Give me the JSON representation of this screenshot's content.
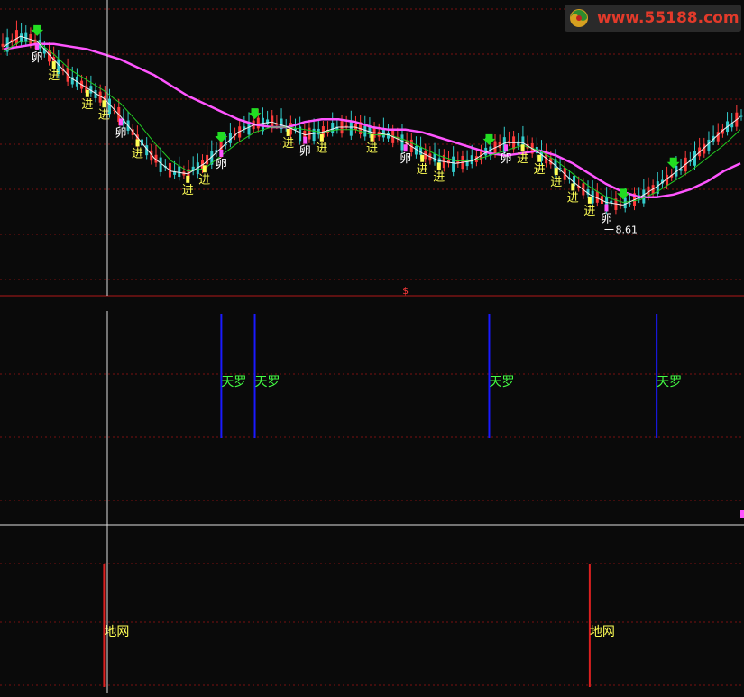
{
  "watermark": {
    "text": "www.55188.com"
  },
  "colors": {
    "background": "#0a0a0a",
    "grid": "#7a1010",
    "up": "#ff3b3b",
    "down": "#33cccc",
    "ma_long": "#ff55ff",
    "ma_mid": "#22cc22",
    "ma_short": "#f0f0f0",
    "signal_in": "#ffff55",
    "signal_out": "#ffffff",
    "arrow_down": "#22dd22",
    "skynet_line": "#1a1aff",
    "skynet_label": "#44ff44",
    "earthnet_line": "#dd2020",
    "earthnet_label": "#ffff55",
    "crosshair": "#dddddd"
  },
  "chart_data": [
    {
      "type": "candlestick",
      "title": "",
      "grid": true,
      "series": [
        {
          "name": "MA long",
          "color": "#ff55ff",
          "values": [
            0.88,
            0.89,
            0.9,
            0.9,
            0.89,
            0.88,
            0.86,
            0.84,
            0.81,
            0.78,
            0.74,
            0.7,
            0.67,
            0.64,
            0.61,
            0.59,
            0.58,
            0.58,
            0.6,
            0.61,
            0.61,
            0.6,
            0.58,
            0.57,
            0.57,
            0.56,
            0.54,
            0.52,
            0.5,
            0.48,
            0.47,
            0.48,
            0.49,
            0.47,
            0.44,
            0.4,
            0.36,
            0.33,
            0.31,
            0.31,
            0.32,
            0.34,
            0.37,
            0.41,
            0.44
          ]
        },
        {
          "name": "MA mid",
          "color": "#22cc22",
          "values": [
            0.87,
            0.91,
            0.91,
            0.86,
            0.8,
            0.76,
            0.72,
            0.67,
            0.6,
            0.52,
            0.45,
            0.41,
            0.42,
            0.47,
            0.52,
            0.56,
            0.58,
            0.58,
            0.57,
            0.56,
            0.57,
            0.57,
            0.55,
            0.55,
            0.53,
            0.5,
            0.47,
            0.45,
            0.45,
            0.47,
            0.49,
            0.51,
            0.49,
            0.45,
            0.4,
            0.35,
            0.31,
            0.29,
            0.3,
            0.33,
            0.37,
            0.41,
            0.46,
            0.51,
            0.57
          ]
        },
        {
          "name": "MA short",
          "color": "#f0f0f0",
          "values": [
            0.89,
            0.93,
            0.91,
            0.84,
            0.77,
            0.73,
            0.69,
            0.62,
            0.54,
            0.46,
            0.41,
            0.4,
            0.44,
            0.5,
            0.56,
            0.59,
            0.6,
            0.58,
            0.55,
            0.56,
            0.58,
            0.58,
            0.56,
            0.55,
            0.52,
            0.48,
            0.45,
            0.44,
            0.45,
            0.49,
            0.52,
            0.52,
            0.48,
            0.43,
            0.37,
            0.32,
            0.29,
            0.28,
            0.31,
            0.35,
            0.4,
            0.45,
            0.51,
            0.57,
            0.62
          ]
        }
      ],
      "signals": [
        {
          "label": "卵",
          "kind": "out",
          "x": 2
        },
        {
          "label": "进",
          "kind": "in",
          "x": 3
        },
        {
          "label": "进",
          "kind": "in",
          "x": 5
        },
        {
          "label": "进",
          "kind": "in",
          "x": 6
        },
        {
          "label": "卵",
          "kind": "out",
          "x": 7
        },
        {
          "label": "进",
          "kind": "in",
          "x": 8
        },
        {
          "label": "进",
          "kind": "in",
          "x": 11
        },
        {
          "label": "进",
          "kind": "in",
          "x": 12
        },
        {
          "label": "卵",
          "kind": "out",
          "x": 13
        },
        {
          "label": "进",
          "kind": "in",
          "x": 17
        },
        {
          "label": "卵",
          "kind": "out",
          "x": 18
        },
        {
          "label": "进",
          "kind": "in",
          "x": 19
        },
        {
          "label": "进",
          "kind": "in",
          "x": 22
        },
        {
          "label": "卵",
          "kind": "out",
          "x": 24
        },
        {
          "label": "进",
          "kind": "in",
          "x": 25
        },
        {
          "label": "进",
          "kind": "in",
          "x": 26
        },
        {
          "label": "卵",
          "kind": "out",
          "x": 30
        },
        {
          "label": "进",
          "kind": "in",
          "x": 31
        },
        {
          "label": "进",
          "kind": "in",
          "x": 32
        },
        {
          "label": "进",
          "kind": "in",
          "x": 33
        },
        {
          "label": "进",
          "kind": "in",
          "x": 34
        },
        {
          "label": "进",
          "kind": "in",
          "x": 35
        },
        {
          "label": "卵",
          "kind": "out",
          "x": 36
        }
      ],
      "arrows": [
        2,
        13,
        15,
        29,
        37,
        40
      ],
      "annotation": {
        "text": "8.61",
        "x": 36
      },
      "marker": {
        "text": "$",
        "x": 24
      }
    },
    {
      "type": "bar",
      "title": "",
      "label": "天罗",
      "x": [
        13,
        15,
        29,
        39
      ]
    },
    {
      "type": "bar",
      "title": "",
      "label": "地网",
      "x": [
        6,
        35
      ]
    }
  ]
}
